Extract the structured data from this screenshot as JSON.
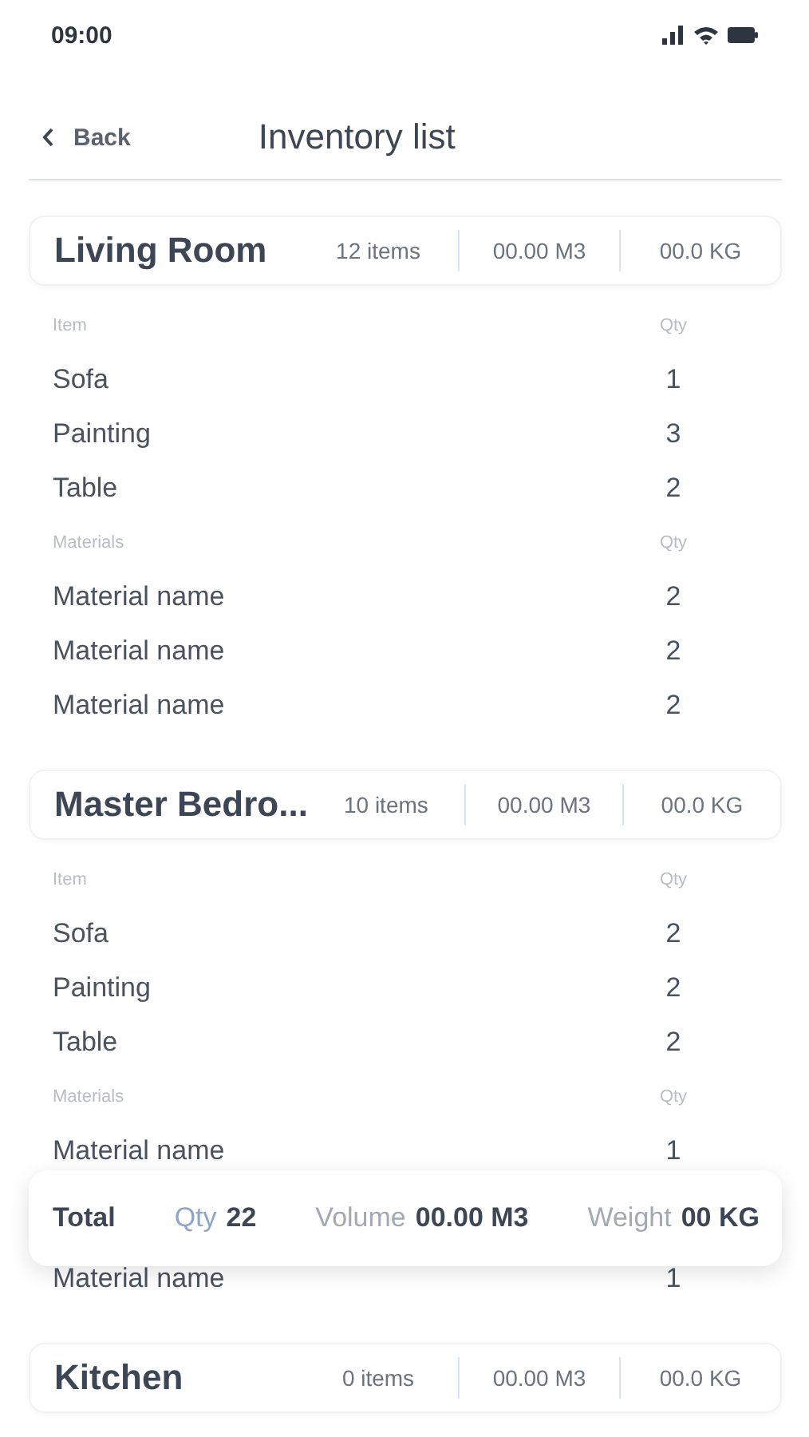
{
  "status_bar": {
    "time": "09:00"
  },
  "nav": {
    "back": "Back",
    "title": "Inventory list"
  },
  "rooms": [
    {
      "name": "Living Room",
      "items": "12 items",
      "volume": "00.00 M3",
      "weight": "00.0 KG",
      "sections": [
        {
          "label": "Item",
          "qty_label": "Qty",
          "rows": [
            {
              "name": "Sofa",
              "qty": "1"
            },
            {
              "name": "Painting",
              "qty": "3"
            },
            {
              "name": "Table",
              "qty": "2"
            }
          ]
        },
        {
          "label": "Materials",
          "qty_label": "Qty",
          "rows": [
            {
              "name": "Material name",
              "qty": "2"
            },
            {
              "name": "Material name",
              "qty": "2"
            },
            {
              "name": "Material name",
              "qty": "2"
            }
          ]
        }
      ]
    },
    {
      "name": "Master Bedro...",
      "items": "10 items",
      "volume": "00.00 M3",
      "weight": "00.0 KG",
      "sections": [
        {
          "label": "Item",
          "qty_label": "Qty",
          "rows": [
            {
              "name": "Sofa",
              "qty": "2"
            },
            {
              "name": "Painting",
              "qty": "2"
            },
            {
              "name": "Table",
              "qty": "2"
            }
          ]
        },
        {
          "label": "Materials",
          "qty_label": "Qty",
          "rows": [
            {
              "name": "Material name",
              "qty": "1"
            },
            {
              "name": "Material name",
              "qty": "1"
            }
          ]
        }
      ]
    },
    {
      "name": "Kitchen",
      "items": "0 items",
      "volume": "00.00 M3",
      "weight": "00.0 KG"
    }
  ],
  "total": {
    "label": "Total",
    "qty_label": "Qty",
    "qty": "22",
    "volume_label": "Volume",
    "volume": "00.00 M3",
    "weight_label": "Weight",
    "weight": "00 KG"
  }
}
